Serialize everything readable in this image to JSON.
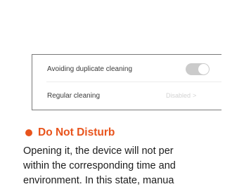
{
  "settings": {
    "rows": [
      {
        "label": "Avoiding duplicate cleaning",
        "control": "toggle",
        "toggle_state": "on"
      },
      {
        "label": "Regular cleaning",
        "control": "link",
        "value": "Disabled",
        "chevron": ">"
      }
    ]
  },
  "section": {
    "title": "Do Not Disturb",
    "lines": [
      "Opening it, the device will not per",
      "within the corresponding time and",
      "environment. In this state, manua"
    ]
  },
  "colors": {
    "accent": "#e8541d",
    "toggle_track": "#cbcbcb",
    "disabled_text": "#d3d3d3"
  }
}
